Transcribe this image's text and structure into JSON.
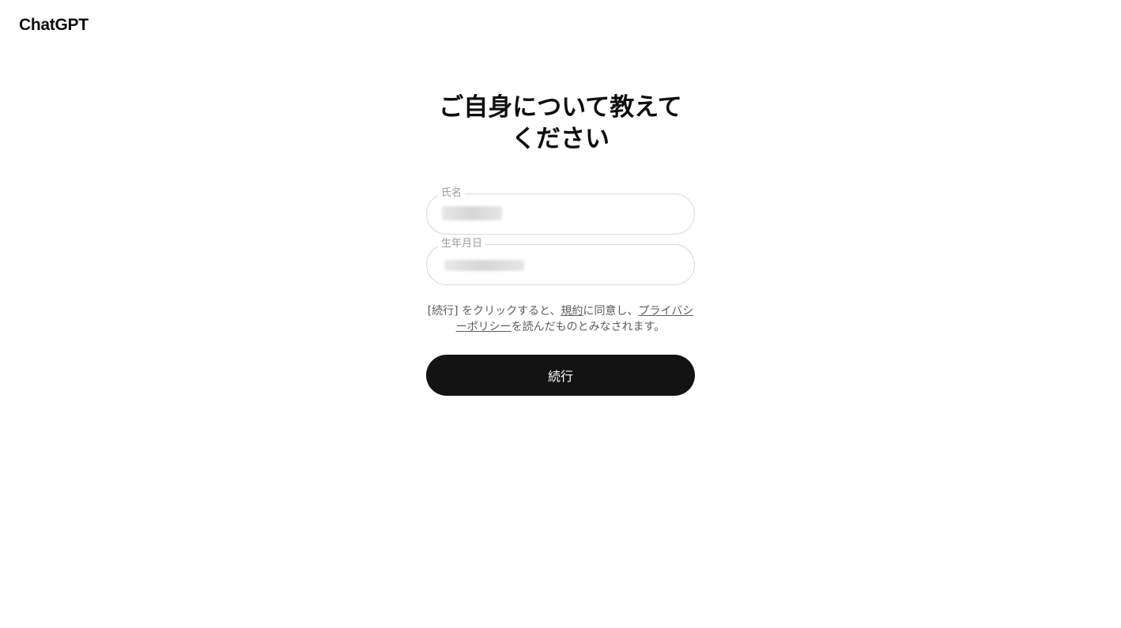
{
  "header": {
    "brand": "ChatGPT"
  },
  "form": {
    "title": "ご自身について教えて\nください",
    "name_field": {
      "label": "氏名",
      "value_redacted": true
    },
    "dob_field": {
      "label": "生年月日",
      "value_redacted": true
    },
    "legal": {
      "part1": "[続行] をクリックすると、",
      "terms_link": "規約",
      "part2": "に同意し、",
      "privacy_link": "プライバシーポリシー",
      "part3": "を読んだものとみなされます。"
    },
    "continue_label": "続行"
  },
  "colors": {
    "button_bg": "#131313",
    "button_text": "#ffffff",
    "field_border": "#d9d9d9",
    "label_text": "#9b9b9b",
    "body_text": "#5d5d5d"
  }
}
